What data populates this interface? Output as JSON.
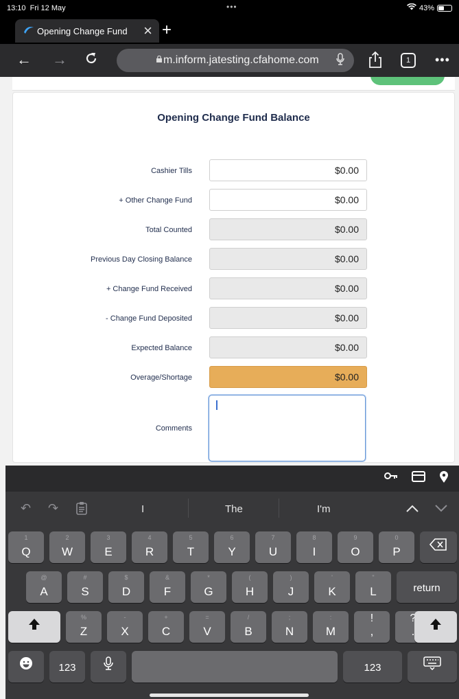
{
  "status_bar": {
    "time": "13:10",
    "date": "Fri 12 May",
    "battery": "43%",
    "battery_fraction": 0.43
  },
  "browser": {
    "tab_title": "Opening Change Fund",
    "url": "m.inform.jatesting.cfahome.com",
    "tab_count": "1"
  },
  "form": {
    "title": "Opening Change Fund Balance",
    "rows": [
      {
        "label": "Cashier Tills",
        "value": "$0.00"
      },
      {
        "label": "+ Other Change Fund",
        "value": "$0.00"
      },
      {
        "label": "Total Counted",
        "value": "$0.00"
      },
      {
        "label": "Previous Day Closing Balance",
        "value": "$0.00"
      },
      {
        "label": "+ Change Fund Received",
        "value": "$0.00"
      },
      {
        "label": "- Change Fund Deposited",
        "value": "$0.00"
      },
      {
        "label": "Expected Balance",
        "value": "$0.00"
      },
      {
        "label": "Overage/Shortage",
        "value": "$0.00"
      }
    ],
    "comments_label": "Comments",
    "comments_value": ""
  },
  "keyboard": {
    "suggestions": [
      "I",
      "The",
      "I'm"
    ],
    "row1": [
      {
        "main": "Q",
        "sub": "1"
      },
      {
        "main": "W",
        "sub": "2"
      },
      {
        "main": "E",
        "sub": "3"
      },
      {
        "main": "R",
        "sub": "4"
      },
      {
        "main": "T",
        "sub": "5"
      },
      {
        "main": "Y",
        "sub": "6"
      },
      {
        "main": "U",
        "sub": "7"
      },
      {
        "main": "I",
        "sub": "8"
      },
      {
        "main": "O",
        "sub": "9"
      },
      {
        "main": "P",
        "sub": "0"
      }
    ],
    "row2": [
      {
        "main": "A",
        "sub": "@"
      },
      {
        "main": "S",
        "sub": "#"
      },
      {
        "main": "D",
        "sub": "$"
      },
      {
        "main": "F",
        "sub": "&"
      },
      {
        "main": "G",
        "sub": "*"
      },
      {
        "main": "H",
        "sub": "("
      },
      {
        "main": "J",
        "sub": ")"
      },
      {
        "main": "K",
        "sub": "'"
      },
      {
        "main": "L",
        "sub": "\""
      }
    ],
    "row3": [
      {
        "main": "Z",
        "sub": "%"
      },
      {
        "main": "X",
        "sub": "-"
      },
      {
        "main": "C",
        "sub": "+"
      },
      {
        "main": "V",
        "sub": "="
      },
      {
        "main": "B",
        "sub": "/"
      },
      {
        "main": "N",
        "sub": ";"
      },
      {
        "main": "M",
        "sub": ":"
      },
      {
        "main": ",",
        "sub": "!"
      },
      {
        "main": ".",
        "sub": "?"
      }
    ],
    "return_label": "return",
    "numbers_label": "123",
    "colors": {
      "key": "#6b6b6e",
      "key_dark": "#505053",
      "highlight": "#e7ad59"
    }
  }
}
